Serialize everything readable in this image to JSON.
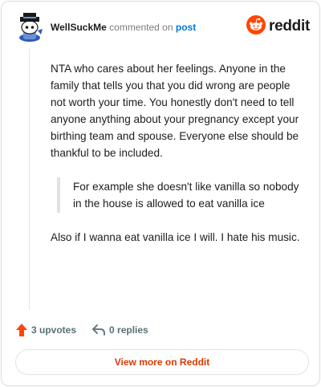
{
  "comment": {
    "author": "WellSuckMe",
    "action_text": "commented on",
    "post_link": "post",
    "brand": "reddit",
    "paragraphs": [
      "NTA who cares about her feelings. Anyone in the family that tells you that you did wrong are people not worth your time. You honestly don't need to tell anyone anything about your pregnancy except your birthing team and spouse. Everyone else should be thankful to be included."
    ],
    "quote": "For example she doesn't like vanilla so nobody in the house is allowed to eat vanilla ice",
    "closing": "Also if I wanna eat vanilla ice I will. I hate his music."
  },
  "footer": {
    "upvotes": "3 upvotes",
    "replies": "0 replies",
    "view_more": "View more on Reddit"
  },
  "colors": {
    "upvote": "#ff4500",
    "link": "#0079d3",
    "view_more": "#d93a00"
  },
  "icons": {
    "avatar": "snoo-avatar",
    "brand": "reddit-logo-icon",
    "upvote": "upvote-arrow-icon",
    "reply": "reply-arrow-icon"
  }
}
